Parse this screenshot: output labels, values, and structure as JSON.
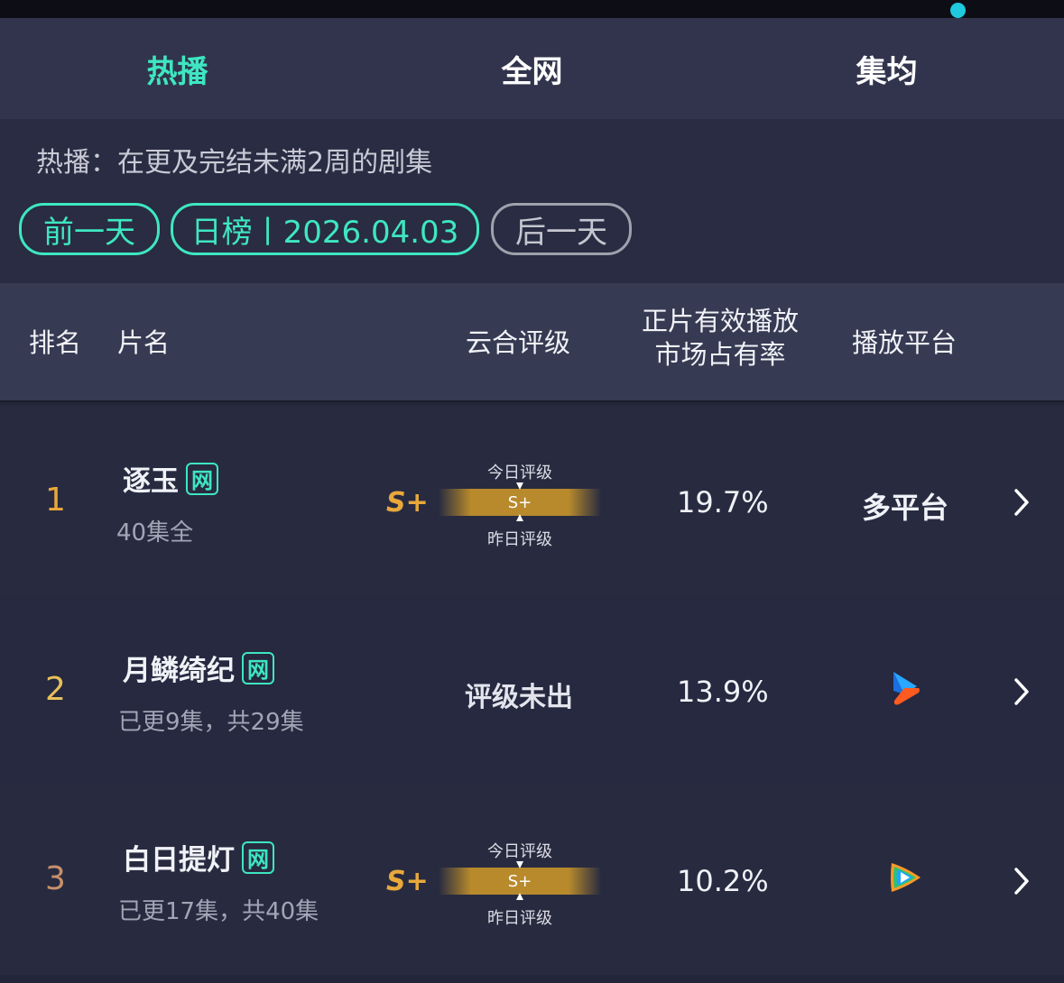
{
  "tabs": [
    {
      "label": "热播",
      "active": true
    },
    {
      "label": "全网",
      "active": false
    },
    {
      "label": "集均",
      "active": false
    }
  ],
  "description": "热播：在更及完结未满2周的剧集",
  "date_nav": {
    "prev_label": "前一天",
    "current_label": "日榜丨2026.04.03",
    "next_label": "后一天"
  },
  "table_header": {
    "rank": "排名",
    "title": "片名",
    "rating": "云合评级",
    "share_line1": "正片有效播放",
    "share_line2": "市场占有率",
    "platform": "播放平台"
  },
  "rows": [
    {
      "rank": "1",
      "title": "逐玉",
      "badge": "网",
      "episodes": "40集全",
      "grade": "S+",
      "today_label": "今日评级",
      "yesterday_label": "昨日评级",
      "bar_grade": "S+",
      "share": "19.7%",
      "platform": "多平台"
    },
    {
      "rank": "2",
      "title": "月鳞绮纪",
      "badge": "网",
      "episodes": "已更9集，共29集",
      "rating_text": "评级未出",
      "share": "13.9%",
      "platform_icon": "youku-play-icon"
    },
    {
      "rank": "3",
      "title": "白日提灯",
      "badge": "网",
      "episodes": "已更17集，共40集",
      "grade": "S+",
      "today_label": "今日评级",
      "yesterday_label": "昨日评级",
      "bar_grade": "S+",
      "share": "10.2%",
      "platform_icon": "tencent-video-icon"
    }
  ],
  "colors": {
    "accent": "#3ee7c1",
    "grade": "#e8a83a",
    "rank1": "#e8a83a",
    "rank2": "#e8c05a",
    "rank3": "#c8906a"
  }
}
